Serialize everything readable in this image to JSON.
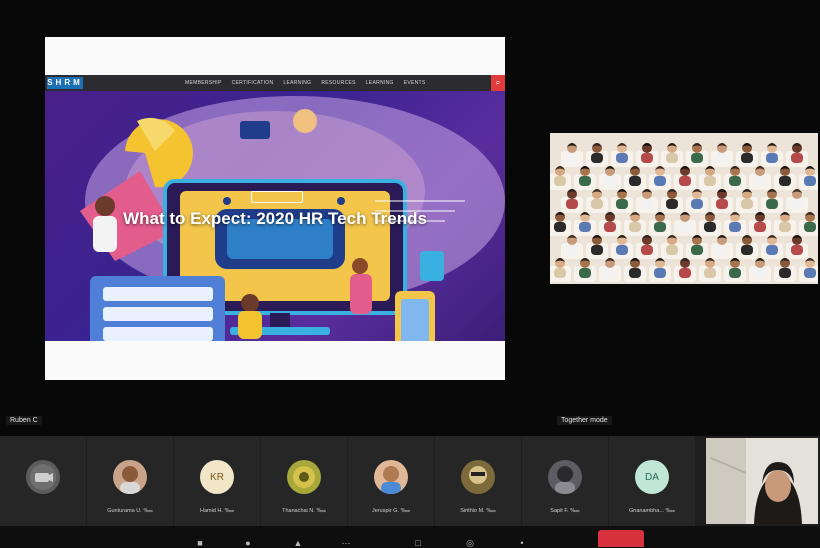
{
  "presentation": {
    "site_logo": "SHRM",
    "nav_items": [
      "MEMBERSHIP",
      "CERTIFICATION",
      "LEARNING",
      "RESOURCES",
      "LEARNING",
      "EVENTS"
    ],
    "hero_badge": "",
    "hero_title": "What to Expect: 2020 HR Tech Trends",
    "hero_subtitle": "",
    "presenter_label": "Ruben C"
  },
  "gallery": {
    "label": "Together mode"
  },
  "participants": [
    {
      "name": "",
      "initials": "",
      "avatar_color": "#6f6f6f"
    },
    {
      "name": "Gunturama U. ‱",
      "initials": "",
      "avatar_color": "#c9a28a"
    },
    {
      "name": "Hamid H. ‱",
      "initials": "KR",
      "avatar_color": "#f1e6c7"
    },
    {
      "name": "Thanachai N. ‱",
      "initials": "",
      "avatar_color": "#a8a83a"
    },
    {
      "name": "Jeruspir G. ‱",
      "initials": "",
      "avatar_color": "#e0b896"
    },
    {
      "name": "Sirithio M. ‱",
      "initials": "",
      "avatar_color": "#7c6a3a"
    },
    {
      "name": "Sapit F. ‱",
      "initials": "",
      "avatar_color": "#5c5c62"
    },
    {
      "name": "Gnanambha... ‱",
      "initials": "DA",
      "avatar_color": "#bfe6d6"
    }
  ],
  "controls": {
    "leave_label": ""
  },
  "colors": {
    "accent_red": "#d8323e",
    "hero_purple": "#4a1f8a"
  }
}
